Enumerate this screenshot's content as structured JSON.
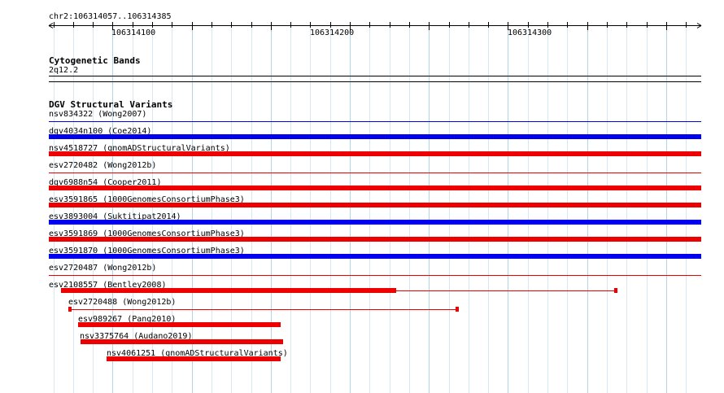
{
  "location": "chr2:106314057..106314385",
  "ruler": {
    "labels": [
      "106314100",
      "106314200",
      "106314300"
    ]
  },
  "cytobands": {
    "title": "Cytogenetic Bands",
    "band": "2q12.2"
  },
  "dgv": {
    "title": "DGV Structural Variants",
    "variants": [
      {
        "id": "nsv834322",
        "study": "Wong2007",
        "label": "nsv834322 (Wong2007)"
      },
      {
        "id": "dgv4034n100",
        "study": "Coe2014",
        "label": "dgv4034n100 (Coe2014)"
      },
      {
        "id": "nsv4518727",
        "study": "gnomADStructuralVariants",
        "label": "nsv4518727 (gnomADStructuralVariants)"
      },
      {
        "id": "esv2720482",
        "study": "Wong2012b",
        "label": "esv2720482 (Wong2012b)"
      },
      {
        "id": "dgv6988n54",
        "study": "Cooper2011",
        "label": "dgv6988n54 (Cooper2011)"
      },
      {
        "id": "esv3591865",
        "study": "1000GenomesConsortiumPhase3",
        "label": "esv3591865 (1000GenomesConsortiumPhase3)"
      },
      {
        "id": "esv3893004",
        "study": "Suktitipat2014",
        "label": "esv3893004 (Suktitipat2014)"
      },
      {
        "id": "esv3591869",
        "study": "1000GenomesConsortiumPhase3",
        "label": "esv3591869 (1000GenomesConsortiumPhase3)"
      },
      {
        "id": "esv3591870",
        "study": "1000GenomesConsortiumPhase3",
        "label": "esv3591870 (1000GenomesConsortiumPhase3)"
      },
      {
        "id": "esv2720487",
        "study": "Wong2012b",
        "label": "esv2720487 (Wong2012b)"
      },
      {
        "id": "esv2108557",
        "study": "Bentley2008",
        "label": "esv2108557 (Bentley2008)"
      },
      {
        "id": "esv2720488",
        "study": "Wong2012b",
        "label": "esv2720488 (Wong2012b)"
      },
      {
        "id": "esv989267",
        "study": "Pang2010",
        "label": "esv989267 (Pang2010)"
      },
      {
        "id": "nsv3375764",
        "study": "Audano2019",
        "label": "nsv3375764 (Audano2019)"
      },
      {
        "id": "nsv4061251",
        "study": "gnomADStructuralVariants",
        "label": "nsv4061251 (gnomADStructuralVariants)"
      }
    ]
  },
  "colors": {
    "gain": "#0000ee",
    "loss": "#ee0000",
    "grid_major": "#b0d4e8",
    "grid_minor": "#d4e8f4"
  }
}
